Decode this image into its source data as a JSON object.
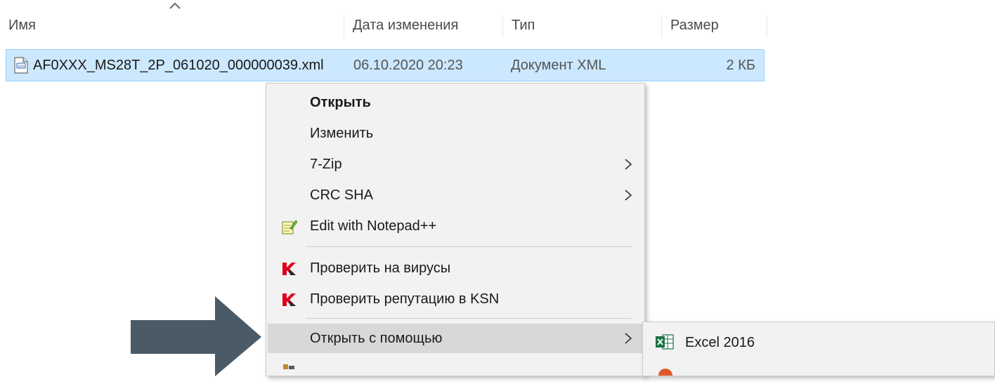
{
  "columns": {
    "name": "Имя",
    "date": "Дата изменения",
    "type": "Тип",
    "size": "Размер"
  },
  "file": {
    "name": "AF0XXX_MS28T_2P_061020_000000039.xml",
    "date": "06.10.2020 20:23",
    "type": "Документ XML",
    "size": "2 КБ",
    "icon": "xml-file-icon"
  },
  "context_menu": {
    "items": [
      {
        "label": "Открыть",
        "bold": true
      },
      {
        "label": "Изменить"
      },
      {
        "label": "7-Zip",
        "submenu": true
      },
      {
        "label": "CRC SHA",
        "submenu": true
      },
      {
        "label": "Edit with Notepad++",
        "icon": "notepad-plus-plus-icon"
      },
      {
        "label": "Проверить на вирусы",
        "icon": "kaspersky-icon"
      },
      {
        "label": "Проверить репутацию в KSN",
        "icon": "kaspersky-icon"
      },
      {
        "label": "Открыть с помощью",
        "submenu": true,
        "selected": true
      }
    ]
  },
  "submenu": {
    "items": [
      {
        "label": "Excel 2016",
        "icon": "excel-icon"
      }
    ]
  },
  "colors": {
    "selection": "#cce8ff",
    "menu_bg": "#f2f2f2",
    "menu_hover": "#d8d8d8",
    "arrow": "#4a5a66",
    "kaspersky_red": "#e0001b",
    "excel_green": "#1e7145"
  }
}
